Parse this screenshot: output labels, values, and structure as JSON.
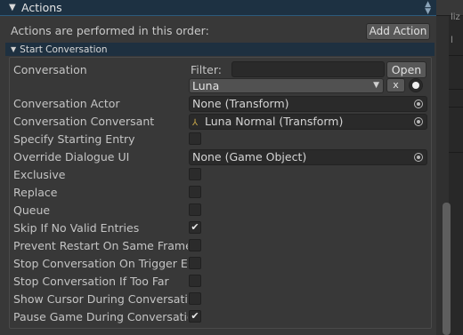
{
  "header": {
    "title": "Actions",
    "collapse_glyph": "▼"
  },
  "side_panel": {
    "clip_text_top": "liz",
    "clip_text_mid": "l"
  },
  "toolbar": {
    "order_text": "Actions are performed in this order:",
    "add_action_label": "Add Action"
  },
  "section": {
    "title": "Start Conversation",
    "collapse_glyph": "▼"
  },
  "conversation": {
    "label": "Conversation",
    "filter_label": "Filter:",
    "filter_value": "",
    "open_label": "Open",
    "selected": "Luna",
    "clear_label": "x"
  },
  "fields": {
    "actor_label": "Conversation Actor",
    "actor_value": "None (Transform)",
    "conversant_label": "Conversation Conversant",
    "conversant_value": "Luna Normal (Transform)",
    "starting_entry_label": "Specify Starting Entry",
    "override_ui_label": "Override Dialogue UI",
    "override_ui_value": "None (Game Object)"
  },
  "toggles": [
    {
      "label": "Exclusive",
      "checked": false
    },
    {
      "label": "Replace",
      "checked": false
    },
    {
      "label": "Queue",
      "checked": false
    },
    {
      "label": "Skip If No Valid Entries",
      "checked": true
    },
    {
      "label": "Prevent Restart On Same Frame Ended",
      "checked": false
    },
    {
      "label": "Stop Conversation On Trigger Exit",
      "checked": false
    },
    {
      "label": "Stop Conversation If Too Far",
      "checked": false
    },
    {
      "label": "Show Cursor During Conversation",
      "checked": false
    },
    {
      "label": "Pause Game During Conversation",
      "checked": true
    }
  ],
  "starting_entry_checked": false,
  "colors": {
    "accent": "#1d3142",
    "panel": "#383838",
    "field": "#2a2a2a"
  },
  "icons": {
    "header_menu": "up-down-chevron-icon",
    "object_picker": "object-picker-icon",
    "transform": "transform-axis-icon",
    "check": "checkmark-icon"
  }
}
